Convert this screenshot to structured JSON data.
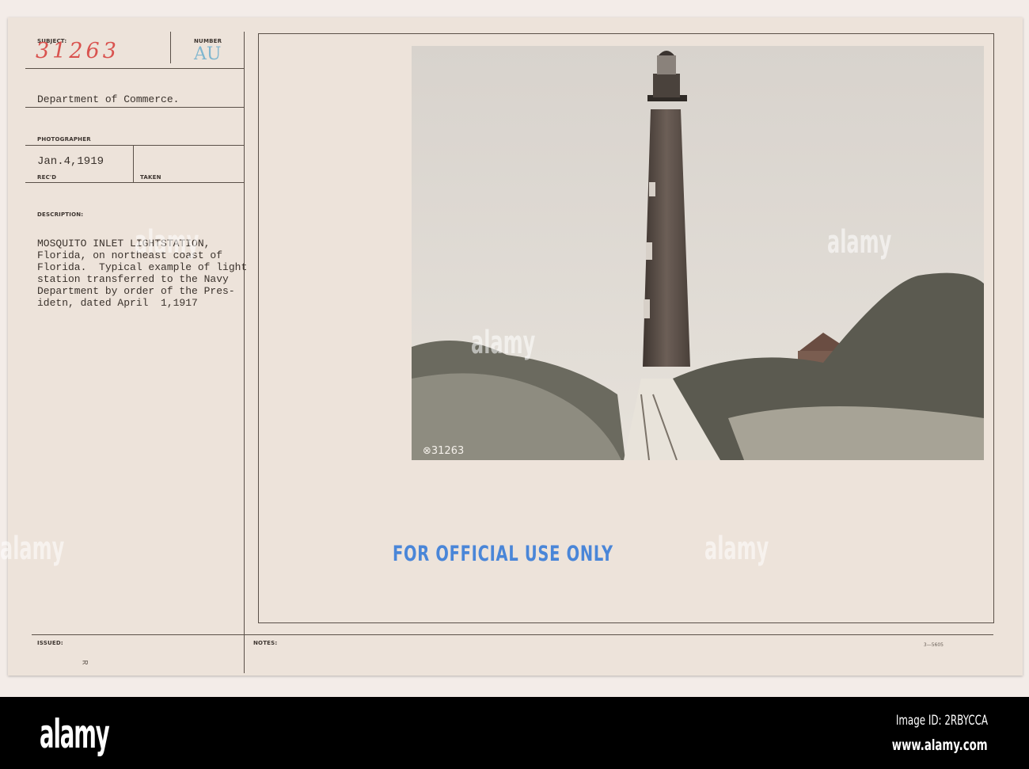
{
  "card": {
    "subject_label": "SUBJECT:",
    "subject_number": "31263",
    "number_label": "NUMBER",
    "number_value": "AU",
    "department": "Department of Commerce.",
    "photographer_label": "PHOTOGRAPHER",
    "recd_date": "Jan.4,1919",
    "recd_label": "REC'D",
    "taken_label": "TAKEN",
    "description_label": "DESCRIPTION:",
    "description_lines": [
      "MOSQUITO INLET LIGHTSTATION,",
      "Florida, on northeast coast of",
      "Florida.  Typical example of light",
      "station transferred to the Navy",
      "Department by order of the Pres-",
      "idetn, dated April  1,1917"
    ],
    "photo_number": "⊗31263",
    "stamp": "FOR OFFICIAL USE ONLY",
    "issued_label": "ISSUED:",
    "notes_label": "NOTES:",
    "form_number": "3—5605",
    "issued_mark": "R"
  },
  "footer": {
    "logo": "alamy",
    "image_id": "Image ID: 2RBYCCA",
    "website": "www.alamy.com"
  },
  "watermark": "alamy"
}
